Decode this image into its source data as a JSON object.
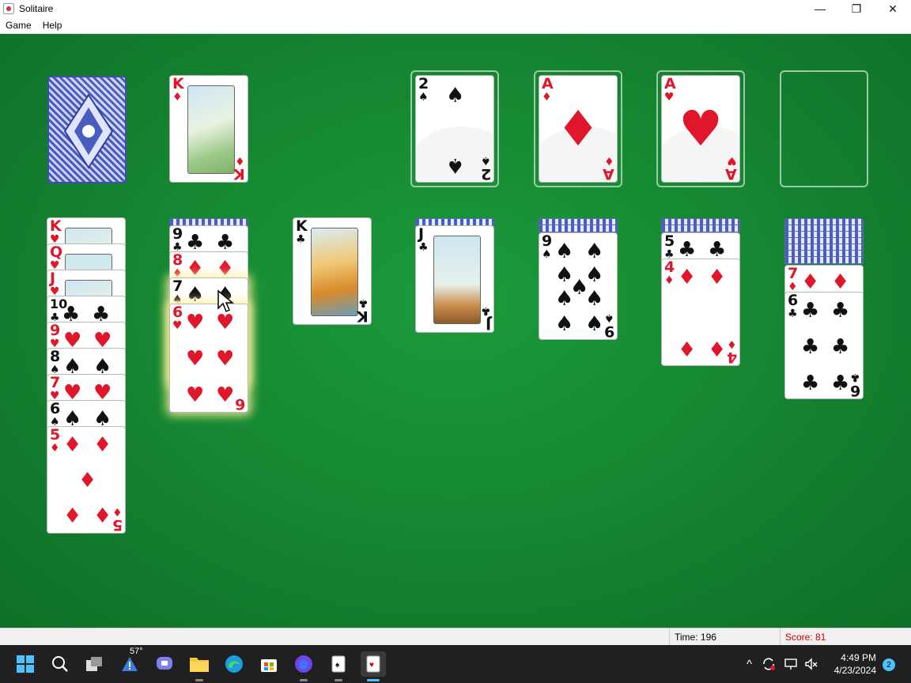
{
  "window": {
    "title": "Solitaire",
    "minimize": "—",
    "maximize": "❐",
    "close": "✕"
  },
  "menu": {
    "game": "Game",
    "help": "Help"
  },
  "status": {
    "time_label": "Time:",
    "time_value": "196",
    "score_label": "Score:",
    "score_value": "81"
  },
  "taskbar": {
    "weather_temp": "57°",
    "clock_time": "4:49 PM",
    "clock_date": "4/23/2024",
    "notification_count": "2"
  },
  "suits": {
    "spade": "♠",
    "club": "♣",
    "heart": "♥",
    "diamond": "♦"
  },
  "cards": {
    "waste_king": {
      "rank": "K",
      "suit": "♦"
    },
    "found_1": {
      "rank": "2",
      "suit": "♠"
    },
    "found_2": {
      "rank": "A",
      "suit": "♦"
    },
    "found_3": {
      "rank": "A",
      "suit": "♥"
    },
    "t1": [
      {
        "rank": "K",
        "suit": "♥"
      },
      {
        "rank": "Q",
        "suit": "♥"
      },
      {
        "rank": "J",
        "suit": "♥"
      },
      {
        "rank": "10",
        "suit": "♣"
      },
      {
        "rank": "9",
        "suit": "♥"
      },
      {
        "rank": "8",
        "suit": "♠"
      },
      {
        "rank": "7",
        "suit": "♥"
      },
      {
        "rank": "6",
        "suit": "♠"
      },
      {
        "rank": "5",
        "suit": "♦"
      }
    ],
    "t2": [
      {
        "rank": "9",
        "suit": "♣"
      },
      {
        "rank": "8",
        "suit": "♦"
      },
      {
        "rank": "7",
        "suit": "♠"
      },
      {
        "rank": "6",
        "suit": "♥"
      }
    ],
    "t3": {
      "rank": "K",
      "suit": "♣"
    },
    "t4": {
      "rank": "J",
      "suit": "♣"
    },
    "t5": {
      "rank": "9",
      "suit": "♠"
    },
    "t6": [
      {
        "rank": "5",
        "suit": "♣"
      },
      {
        "rank": "4",
        "suit": "♦"
      }
    ],
    "t7": [
      {
        "rank": "7",
        "suit": "♦"
      },
      {
        "rank": "6",
        "suit": "♣"
      }
    ]
  },
  "colors": {
    "table_green": "#168a33",
    "red_suit": "#e0162b",
    "score_red": "#c00"
  }
}
